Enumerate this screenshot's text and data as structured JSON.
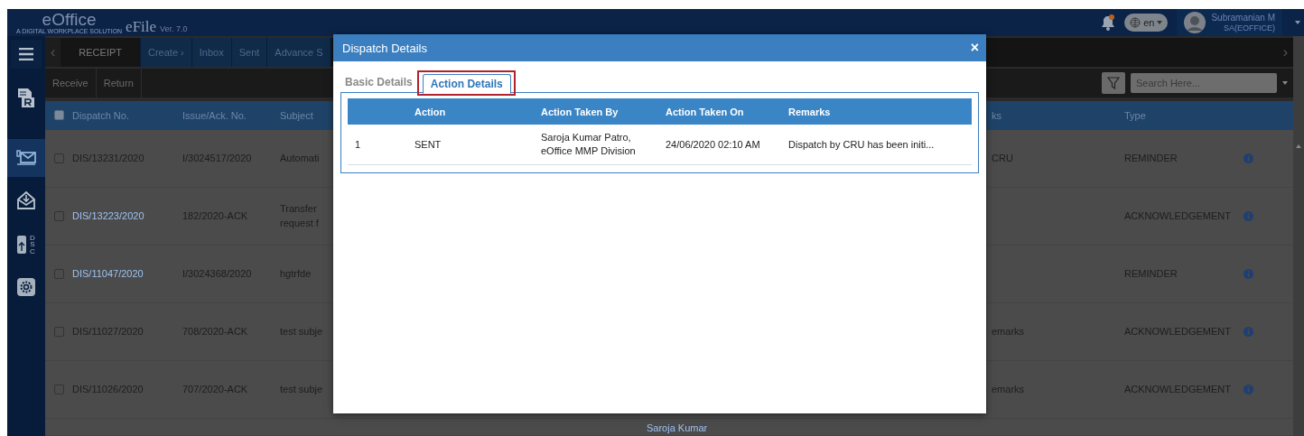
{
  "header": {
    "logo": "eOffice",
    "tagline": "A DIGITAL WORKPLACE SOLUTION",
    "product": "eFile",
    "version": "Ver. 7.0",
    "language": "en",
    "user_name": "Subramanian M",
    "user_role": "SA(EOFFICE)"
  },
  "sidebar": {
    "items": [
      {
        "kind": "menu",
        "selected": false
      },
      {
        "kind": "receipt",
        "selected": false
      },
      {
        "kind": "dispatch",
        "selected": true
      },
      {
        "kind": "inbox",
        "selected": false
      },
      {
        "kind": "dsc",
        "label": "DSC",
        "selected": false
      },
      {
        "kind": "settings",
        "selected": false
      }
    ]
  },
  "nav_back": "‹",
  "nav_forward": "›",
  "nav": [
    {
      "label": "RECEIPT",
      "kind": "module"
    },
    {
      "label": "Create ›",
      "kind": "link"
    },
    {
      "label": "Inbox",
      "kind": "link"
    },
    {
      "label": "Sent",
      "kind": "link"
    },
    {
      "label": "Advance S",
      "kind": "link"
    }
  ],
  "actions": [
    "Receive",
    "Return"
  ],
  "search": {
    "placeholder": "Search Here..."
  },
  "table": {
    "select_all_checked": false,
    "columns": {
      "dispatch_no": "Dispatch No.",
      "issue_no": "Issue/Ack. No.",
      "subject": "Subject",
      "column_6": "ks",
      "type": "Type"
    },
    "rows": [
      {
        "checked": false,
        "dispatch_no": "DIS/13231/2020",
        "link": false,
        "issue_no": "I/3024517/2020",
        "subject": "Automati",
        "column_6": "CRU",
        "type": "REMINDER"
      },
      {
        "checked": false,
        "dispatch_no": "DIS/13223/2020",
        "link": true,
        "issue_no": "182/2020-ACK",
        "subject": "Transfer\nrequest f",
        "type": "ACKNOWLEDGEMENT"
      },
      {
        "checked": false,
        "dispatch_no": "DIS/11047/2020",
        "link": true,
        "issue_no": "I/3024368/2020",
        "subject": "hgtrfde",
        "type": "REMINDER"
      },
      {
        "checked": false,
        "dispatch_no": "DIS/11027/2020",
        "link": false,
        "issue_no": "708/2020-ACK",
        "subject": "test subje",
        "column_6": "emarks",
        "type": "ACKNOWLEDGEMENT"
      },
      {
        "checked": false,
        "dispatch_no": "DIS/11026/2020",
        "link": false,
        "issue_no": "707/2020-ACK",
        "subject": "test subje",
        "column_6": "emarks",
        "type": "ACKNOWLEDGEMENT"
      },
      {
        "column_5": "Saroja Kumar"
      }
    ]
  },
  "modal": {
    "title": "Dispatch Details",
    "close": "×",
    "tabs": [
      {
        "label": "Basic Details",
        "selected": false
      },
      {
        "label": "Action Details",
        "selected": true
      }
    ],
    "table": {
      "columns": [
        "Action",
        "Action Taken By",
        "Action Taken On",
        "Remarks"
      ],
      "rows": [
        {
          "index": "1",
          "action": "SENT",
          "taken_by": "Saroja Kumar Patro,\neOffice MMP Division",
          "taken_on": "24/06/2020 02:10 AM",
          "remarks": "Dispatch by CRU has been initi..."
        }
      ]
    }
  }
}
